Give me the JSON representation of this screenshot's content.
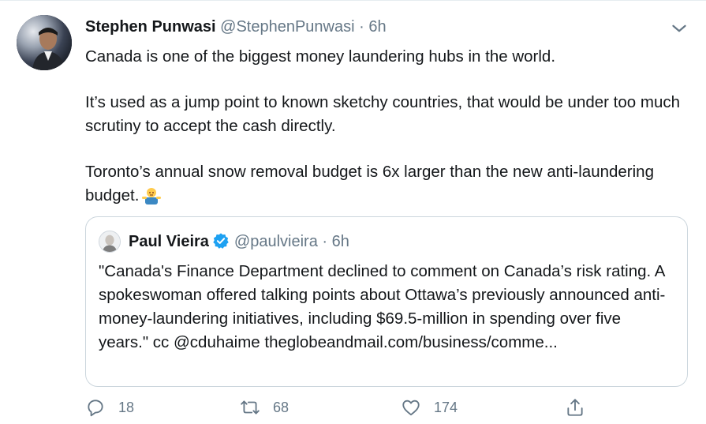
{
  "tweet": {
    "display_name": "Stephen Punwasi",
    "handle": "@StephenPunwasi",
    "separator": "·",
    "time": "6h",
    "paragraphs": [
      "Canada is one of the biggest money laundering hubs in the world.",
      "It’s used as a jump point to known sketchy countries, that would be under too much scrutiny to accept the cash directly.",
      "Toronto’s annual snow removal budget is 6x larger than the new anti-laundering budget."
    ],
    "emoji_icon": "person-shrugging-emoji"
  },
  "quoted": {
    "display_name": "Paul Vieira",
    "handle": "@paulvieira",
    "separator": "·",
    "time": "6h",
    "text": "\"Canada's Finance Department declined to comment on Canada’s risk rating. A spokeswoman offered talking points about Ottawa’s previously announced anti-money-laundering initiatives, including $69.5-million in spending over five years.\" cc @cduhaime theglobeandmail.com/business/comme..."
  },
  "actions": {
    "reply_count": "18",
    "retweet_count": "68",
    "like_count": "174"
  },
  "colors": {
    "secondary_text": "#657786",
    "border": "#ccd6dd",
    "verified_blue": "#1da1f2"
  }
}
